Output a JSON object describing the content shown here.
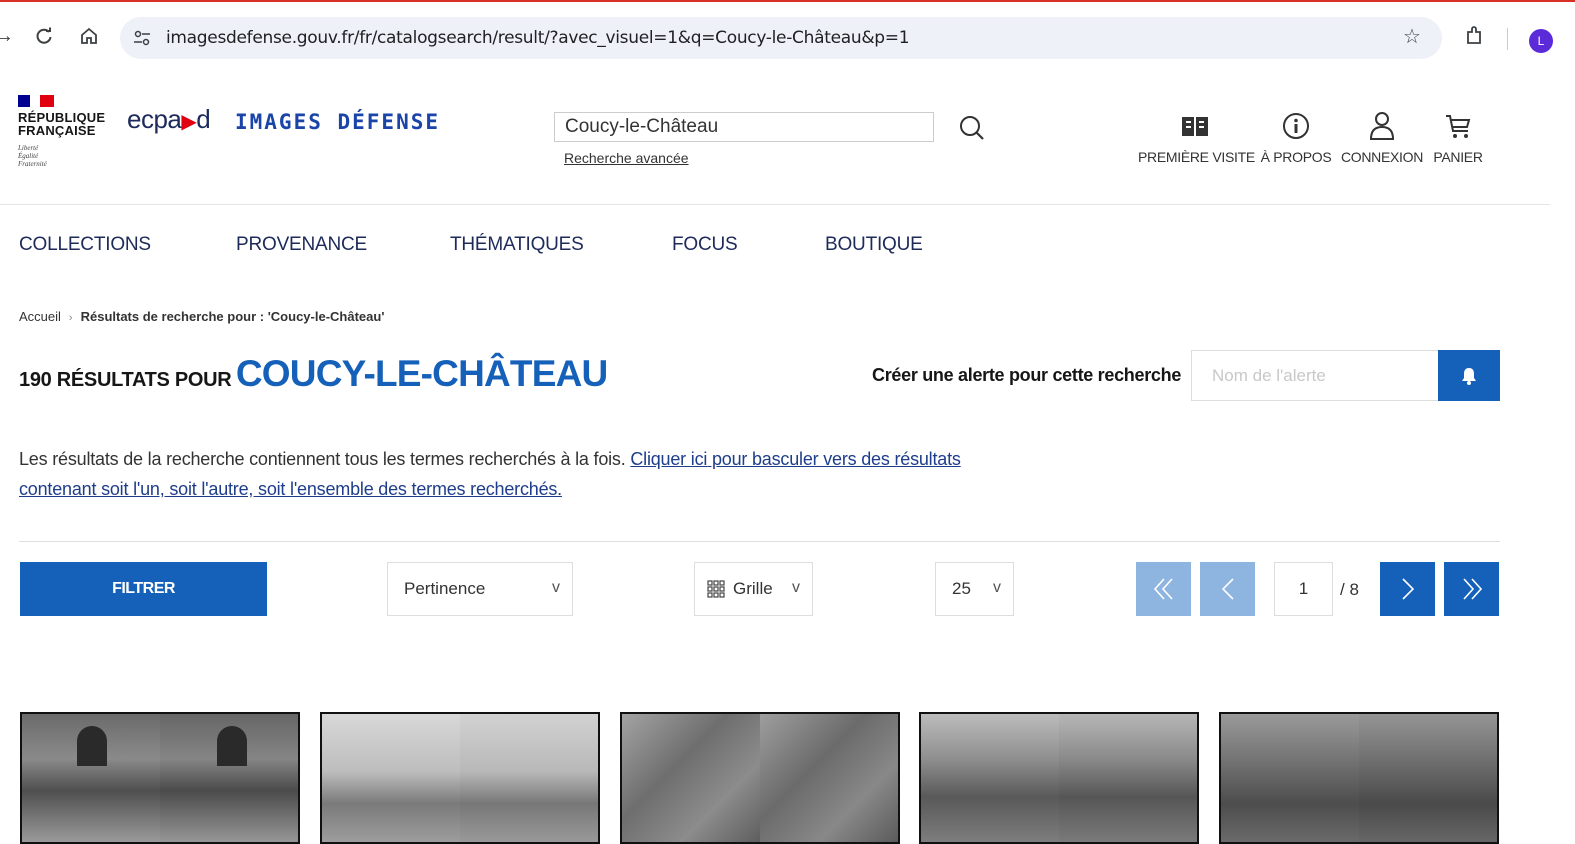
{
  "browser": {
    "url": "imagesdefense.gouv.fr/fr/catalogsearch/result/?avec_visuel=1&q=Coucy-le-Château&p=1",
    "profile_initial": "L"
  },
  "header": {
    "rf_line1": "RÉPUBLIQUE",
    "rf_line2": "FRANÇAISE",
    "motto1": "Liberté",
    "motto2": "Égalité",
    "motto3": "Fraternité",
    "ecpad_left": "ecpa",
    "ecpad_right": "d",
    "brand": "IMAGES DÉFENSE",
    "search_value": "Coucy-le-Château",
    "advanced_search": "Recherche avancée",
    "items": [
      {
        "label": "PREMIÈRE VISITE",
        "icon": "book-icon"
      },
      {
        "label": "À PROPOS",
        "icon": "info-icon"
      },
      {
        "label": "CONNEXION",
        "icon": "user-icon"
      },
      {
        "label": "PANIER",
        "icon": "cart-icon"
      }
    ]
  },
  "nav": [
    "COLLECTIONS",
    "PROVENANCE",
    "THÉMATIQUES",
    "FOCUS",
    "BOUTIQUE"
  ],
  "breadcrumb": {
    "home": "Accueil",
    "sep": "›",
    "current": "Résultats de recherche pour : 'Coucy-le-Château'"
  },
  "results": {
    "prefix": "190 RÉSULTATS POUR",
    "query": "COUCY-LE-CHÂTEAU",
    "alert_label": "Créer une alerte pour cette recherche",
    "alert_placeholder": "Nom de l'alerte",
    "info_text": "Les résultats de la recherche contiennent tous les termes recherchés à la fois. ",
    "info_link_part1": "Cliquer ici",
    "info_link_part2": " pour basculer vers des résultats",
    "info_link_line2": "contenant soit l'un, soit l'autre, soit l'ensemble des termes recherchés."
  },
  "toolbar": {
    "filter": "FILTRER",
    "sort": "Pertinence",
    "view": "Grille",
    "per_page": "25",
    "chevron": "v",
    "page_current": "1",
    "page_total": "/ 8"
  },
  "colors": {
    "primary": "#1560b8",
    "primary_disabled": "#8eb4e0",
    "nav_text": "#1e2a5a"
  }
}
